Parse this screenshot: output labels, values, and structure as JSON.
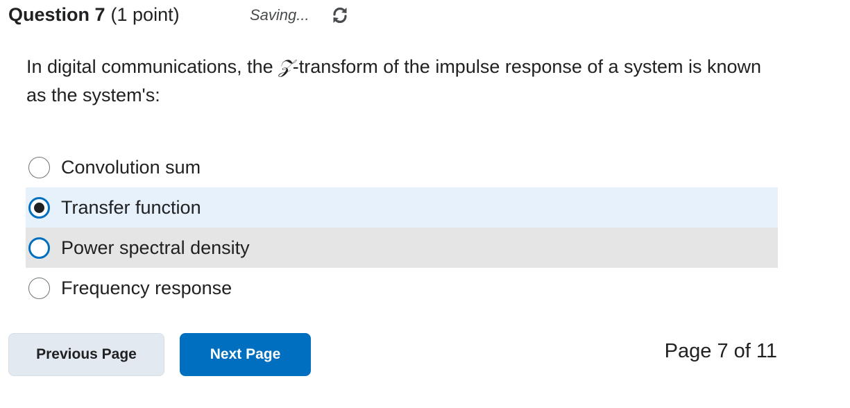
{
  "question": {
    "title": "Question 7",
    "points": "(1 point)",
    "status": "Saving...",
    "status_icon": "sync-icon",
    "text_before": "In digital communications, the ",
    "z_symbol": "𝒵",
    "text_after": "-transform of the impulse response of a system is known as the system's:"
  },
  "options": [
    {
      "label": "Convolution sum",
      "selected": false
    },
    {
      "label": "Transfer function",
      "selected": true
    },
    {
      "label": "Power spectral density",
      "selected": false
    },
    {
      "label": "Frequency response",
      "selected": false
    }
  ],
  "navigation": {
    "previous_label": "Previous Page",
    "next_label": "Next Page",
    "page_indicator": "Page 7 of 11"
  },
  "colors": {
    "accent": "#006fbf",
    "selected_bg": "#e6f1fb",
    "hover_bg": "#e5e5e5",
    "secondary_button_bg": "#e3e9f1"
  }
}
